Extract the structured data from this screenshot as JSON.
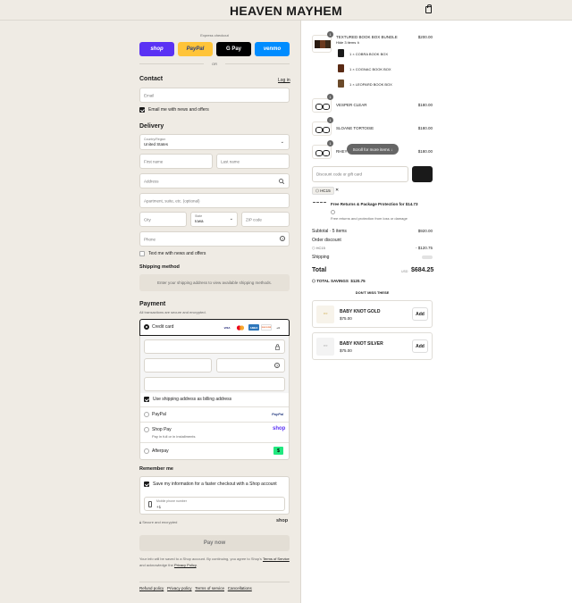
{
  "header": {
    "brand": "HEAVEN MAYHEM",
    "bag_icon": "bag-icon"
  },
  "express": {
    "label": "Express checkout",
    "buttons": [
      {
        "label": "shop",
        "color": "#5a31f4"
      },
      {
        "label": "PayPal",
        "color": "#ffc439"
      },
      {
        "label": "G Pay",
        "color": "#000000"
      },
      {
        "label": "venmo",
        "color": "#008cff"
      }
    ],
    "or": "OR"
  },
  "contact": {
    "title": "Contact",
    "login": "Log in",
    "email_placeholder": "Email",
    "news_label": "Email me with news and offers"
  },
  "delivery": {
    "title": "Delivery",
    "country_label": "Country/Region",
    "country_value": "United States",
    "first_name": "First name",
    "last_name": "Last name",
    "address": "Address",
    "apartment": "Apartment, suite, etc. (optional)",
    "city": "City",
    "state_label": "State",
    "state_value": "Iowa",
    "zip": "ZIP code",
    "phone": "Phone",
    "text_label": "Text me with news and offers"
  },
  "shipping": {
    "title": "Shipping method",
    "message": "Enter your shipping address to view available shipping methods."
  },
  "payment": {
    "title": "Payment",
    "subtitle": "All transactions are secure and encrypted.",
    "credit_card": "Credit card",
    "card_logos": [
      "VISA",
      "MC",
      "AMEX",
      "DISCOVER",
      "+4"
    ],
    "billing_label": "Use shipping address as billing address",
    "paypal": "PayPal",
    "paypal_logo": "PayPal",
    "shop_pay": "Shop Pay",
    "shop_pay_sub": "Pay in full or in installments",
    "shop_logo": "shop",
    "afterpay": "Afterpay",
    "afterpay_logo": "$"
  },
  "remember": {
    "title": "Remember me",
    "save_label": "Save my information for a faster checkout with a Shop account",
    "mobile_label": "Mobile phone number",
    "mobile_value": "+1",
    "secure": "Secure and encrypted",
    "shop": "shop"
  },
  "pay_now": "Pay now",
  "legal": {
    "line1": "Your info will be saved to a Shop account. By continuing, you agree to Shop's",
    "tos": "Terms of Service",
    "and": "and acknowledge the",
    "privacy": "Privacy Policy",
    "end": "."
  },
  "footer": [
    "Refund policy",
    "Privacy policy",
    "Terms of service",
    "Cancellations"
  ],
  "order": {
    "items": [
      {
        "title": "TEXTURED BOOK BOX BUNDLE",
        "price": "$200.00",
        "qty": "1",
        "toggle": "Hide 3 items ∧"
      },
      {
        "title": "VESPER CLEAR",
        "price": "$180.00",
        "qty": "1"
      },
      {
        "title": "SLOANE TORTOISE",
        "price": "$180.00",
        "qty": "1"
      },
      {
        "title": "RHEY",
        "price": "$180.00",
        "qty": "1"
      }
    ],
    "bundle": [
      {
        "label": "1 × COBRA BOOK BOX",
        "color": "#1a1a1a"
      },
      {
        "label": "1 × COGNAC BOOK BOX",
        "color": "#5a2a14"
      },
      {
        "label": "1 × LEOPARD BOOK BOX",
        "color": "#6b4a2a"
      }
    ],
    "scroll_hint": "Scroll for more items",
    "discount_placeholder": "Discount code or gift card",
    "code_tag": "HC15",
    "protection_title": "Free Returns & Package Protection for $14.73",
    "protection_sub": "Free returns and protection from loss or damage",
    "subtotal_label": "Subtotal · 5 items",
    "subtotal": "$920.00",
    "order_discount": "Order discount",
    "discount_code": "HC15",
    "discount_amount": "- $120.75",
    "shipping_label": "Shipping",
    "total_label": "Total",
    "currency": "USD",
    "total": "$684.25",
    "savings_label": "TOTAL SAVINGS",
    "savings": "$120.75",
    "dont_miss": "DON'T MISS THESE",
    "upsells": [
      {
        "title": "BABY KNOT GOLD",
        "price": "$75.00",
        "add": "Add"
      },
      {
        "title": "BABY KNOT SILVER",
        "price": "$75.00",
        "add": "Add"
      }
    ]
  }
}
